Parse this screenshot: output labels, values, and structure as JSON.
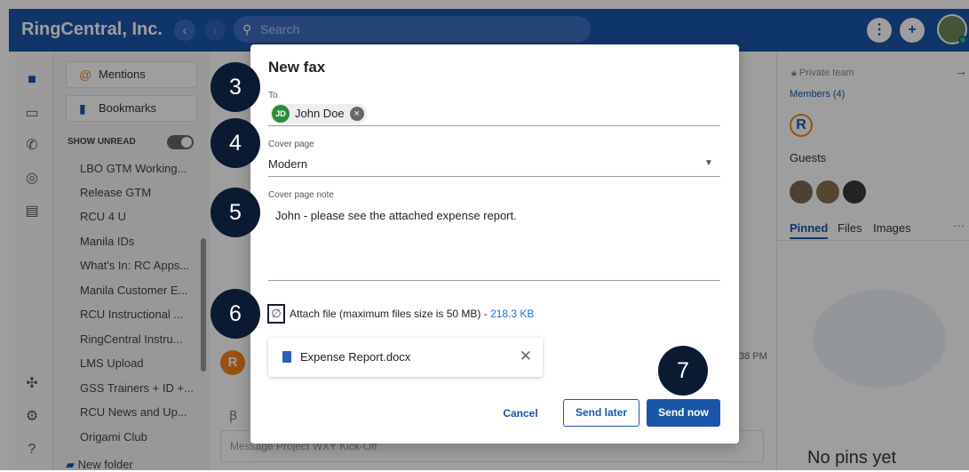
{
  "app": {
    "title": "RingCentral, Inc.",
    "search_placeholder": "Search"
  },
  "sidebar": {
    "mentions": "Mentions",
    "bookmarks": "Bookmarks",
    "show_unread": "SHOW UNREAD",
    "items": [
      "LBO GTM Working...",
      "Release GTM",
      "RCU 4 U",
      "Manila IDs",
      "What's In: RC Apps...",
      "Manila Customer E...",
      "RCU Instructional ...",
      "RingCentral Instru...",
      "LMS Upload",
      "GSS Trainers + ID +...",
      "RCU News and Up...",
      "Origami Club"
    ],
    "new_folder": "New folder"
  },
  "main": {
    "compose_placeholder": "Message Project WXY Kick-Off",
    "time_fragment": "38 PM"
  },
  "right_panel": {
    "private_team": "Private team",
    "members": "Members (4)",
    "guests": "Guests",
    "tabs": [
      "Pinned",
      "Files",
      "Images"
    ],
    "more": "···",
    "no_pins": "No pins yet"
  },
  "modal": {
    "title": "New fax",
    "to_label": "To",
    "recipient": {
      "initials": "JD",
      "name": "John Doe"
    },
    "cover_label": "Cover page",
    "cover_value": "Modern",
    "note_label": "Cover page note",
    "note_value": "John - please see the attached expense report.",
    "attach_text": "Attach file (maximum files size is 50 MB) - ",
    "attach_size": "218.3 KB",
    "file_name": "Expense Report.docx",
    "cancel": "Cancel",
    "send_later": "Send later",
    "send_now": "Send now"
  },
  "steps": [
    "3",
    "4",
    "5",
    "6",
    "7"
  ],
  "colors": {
    "brand": "#1a56a8",
    "step_badge": "#0a1a33",
    "accent_orange": "#f5821f"
  }
}
